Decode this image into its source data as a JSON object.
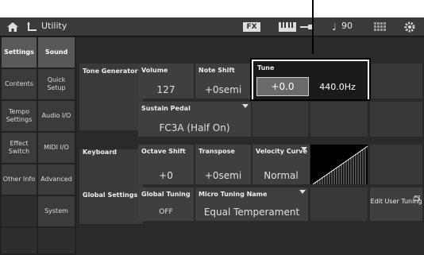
{
  "header": {
    "title": "Utility",
    "fx_badge": "FX",
    "tempo": "90"
  },
  "nav_main": [
    {
      "label": "Settings",
      "selected": true
    },
    {
      "label": "Contents",
      "selected": false
    },
    {
      "label": "Tempo Settings",
      "selected": false
    },
    {
      "label": "Effect Switch",
      "selected": false
    },
    {
      "label": "Other Info",
      "selected": false
    }
  ],
  "nav_sub": [
    {
      "label": "Sound",
      "selected": true
    },
    {
      "label": "Quick Setup",
      "selected": false
    },
    {
      "label": "Audio I/O",
      "selected": false
    },
    {
      "label": "MIDI I/O",
      "selected": false
    },
    {
      "label": "Advanced",
      "selected": false
    },
    {
      "label": "System",
      "selected": false
    }
  ],
  "sections": {
    "tone_generator": "Tone Generator",
    "keyboard": "Keyboard",
    "global_settings": "Global Settings"
  },
  "params": {
    "volume": {
      "label": "Volume",
      "value": "127"
    },
    "note_shift": {
      "label": "Note Shift",
      "value": "+0semi"
    },
    "tune": {
      "label": "Tune",
      "value": "+0.0",
      "hz": "440.0Hz"
    },
    "sustain_pedal": {
      "label": "Sustain Pedal",
      "value": "FC3A (Half On)"
    },
    "octave_shift": {
      "label": "Octave Shift",
      "value": "+0"
    },
    "transpose": {
      "label": "Transpose",
      "value": "+0semi"
    },
    "velocity_curve": {
      "label": "Velocity Curve",
      "value": "Normal"
    },
    "global_tuning": {
      "label": "Global Tuning",
      "value": "OFF"
    },
    "micro_tuning_name": {
      "label": "Micro Tuning Name",
      "value": "Equal Temperament"
    },
    "edit_user_tuning": {
      "label": "Edit User Tuning"
    }
  },
  "colors": {
    "background": "#222222",
    "cell": "#3f3f3f",
    "highlight_border": "#ffffff",
    "tune_value_bg": "#6a6a6a"
  }
}
